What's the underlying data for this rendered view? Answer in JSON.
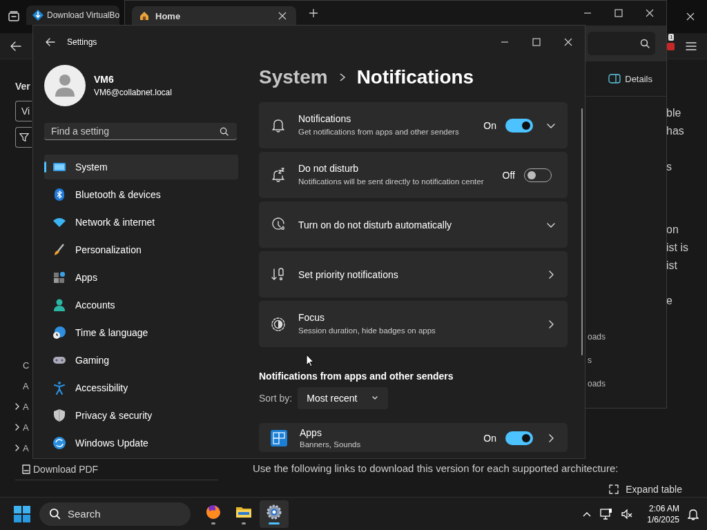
{
  "back_browser": {
    "tab_title": "Download VirtualBo",
    "badge": "1",
    "page": {
      "heading": "Ver",
      "version_field": "Vi",
      "nav_items": [
        {
          "label": "C",
          "expandable": false
        },
        {
          "label": "A",
          "expandable": false
        },
        {
          "label": "A",
          "expandable": true
        },
        {
          "label": "A",
          "expandable": true
        },
        {
          "label": "A",
          "expandable": true
        }
      ],
      "download_pdf": "Download PDF",
      "paragraph_lines": [
        "ble",
        "has",
        "s",
        "on",
        "ist is",
        "ist",
        "e"
      ],
      "instruction": "Use the following links to download this version for each supported architecture:",
      "expand_table": "Expand table"
    }
  },
  "front_browser": {
    "tab_title": "Home",
    "details_button": "Details",
    "panel_lines": [
      "oads",
      "s",
      "oads"
    ]
  },
  "settings": {
    "title": "Settings",
    "user": {
      "name": "VM6",
      "email": "VM6@collabnet.local"
    },
    "search": {
      "placeholder": "Find a setting"
    },
    "nav": [
      {
        "label": "System",
        "selected": true
      },
      {
        "label": "Bluetooth & devices",
        "selected": false
      },
      {
        "label": "Network & internet",
        "selected": false
      },
      {
        "label": "Personalization",
        "selected": false
      },
      {
        "label": "Apps",
        "selected": false
      },
      {
        "label": "Accounts",
        "selected": false
      },
      {
        "label": "Time & language",
        "selected": false
      },
      {
        "label": "Gaming",
        "selected": false
      },
      {
        "label": "Accessibility",
        "selected": false
      },
      {
        "label": "Privacy & security",
        "selected": false
      },
      {
        "label": "Windows Update",
        "selected": false
      }
    ],
    "breadcrumb": [
      "System",
      "Notifications"
    ],
    "cards": [
      {
        "kind": "toggle",
        "title": "Notifications",
        "description": "Get notifications from apps and other senders",
        "on": true,
        "state_label": "On",
        "expandable": true
      },
      {
        "kind": "toggle",
        "title": "Do not disturb",
        "description": "Notifications will be sent directly to notification center",
        "on": false,
        "state_label": "Off",
        "expandable": false
      },
      {
        "kind": "expander",
        "title": "Turn on do not disturb automatically"
      },
      {
        "kind": "link",
        "title": "Set priority notifications"
      },
      {
        "kind": "link",
        "title": "Focus",
        "description": "Session duration, hide badges on apps"
      }
    ],
    "section_title": "Notifications from apps and other senders",
    "sort": {
      "label": "Sort by:",
      "value": "Most recent"
    },
    "app_cards": [
      {
        "title": "Apps",
        "description": "Banners, Sounds",
        "on": true,
        "state_label": "On"
      }
    ]
  },
  "taskbar": {
    "search_placeholder": "Search",
    "apps": [
      {
        "selected": false
      },
      {
        "selected": false
      },
      {
        "selected": true
      }
    ],
    "time": "2:06 AM",
    "date": "1/6/2025"
  }
}
